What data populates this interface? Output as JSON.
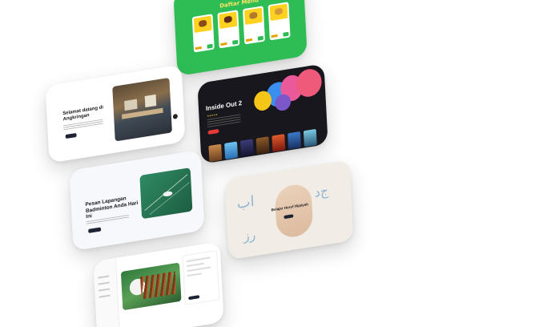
{
  "menu_card": {
    "title": "Daftar Menu",
    "accent": "#2ebd55",
    "highlight": "#ffd21f"
  },
  "movie_card": {
    "title": "Inside Out 2",
    "background": "#17171d",
    "accent": "#e53935"
  },
  "angkringan_card": {
    "title": "Selamat datang di Angkringan"
  },
  "badminton_card": {
    "title": "Pesan Lapangan Badminton Anda Hari Ini"
  },
  "hijaiyah_card": {
    "title": "Belajar Huruf Hijaiyah"
  },
  "sate_card": {
    "accent": "#1e2433"
  }
}
